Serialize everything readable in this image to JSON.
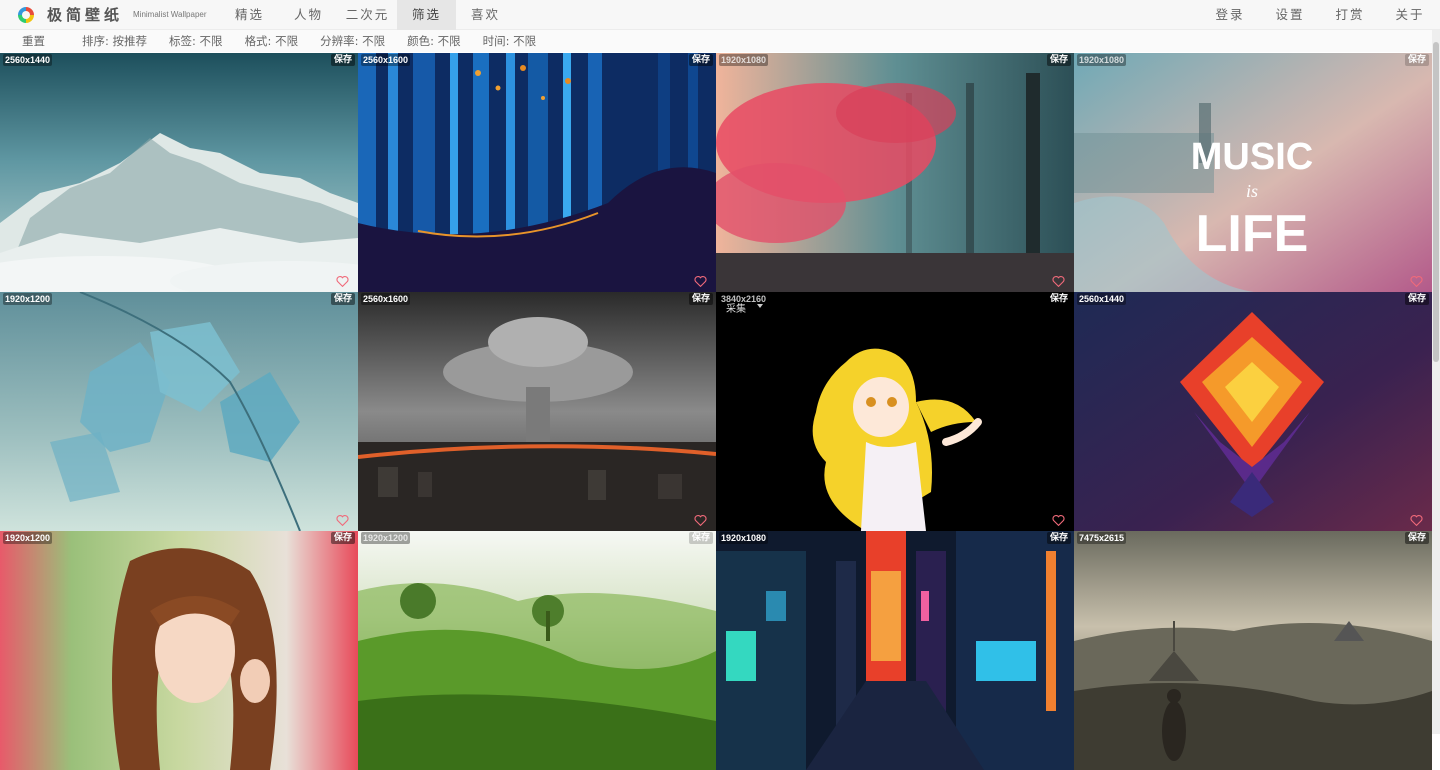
{
  "app": {
    "title": "极简壁纸",
    "subtitle": "Minimalist Wallpaper"
  },
  "nav": [
    {
      "label": "精选"
    },
    {
      "label": "人物"
    },
    {
      "label": "二次元"
    },
    {
      "label": "筛选"
    },
    {
      "label": "喜欢"
    }
  ],
  "active_nav": "筛选",
  "right_nav": [
    {
      "label": "登录"
    },
    {
      "label": "设置"
    },
    {
      "label": "打赏"
    },
    {
      "label": "关于"
    }
  ],
  "filters": {
    "reset": "重置",
    "sort": "排序: 按推荐",
    "tags": "标签: 不限",
    "format": "格式: 不限",
    "resolution": "分辨率: 不限",
    "color": "颜色: 不限",
    "time": "时间: 不限"
  },
  "tiles": [
    {
      "resolution": "2560x1440",
      "save": "保存",
      "scene": "mountain-icon"
    },
    {
      "resolution": "2560x1600",
      "save": "保存",
      "scene": "forest-icon"
    },
    {
      "resolution": "1920x1080",
      "save": "保存",
      "scene": "autumn-tree-icon"
    },
    {
      "resolution": "1920x1080",
      "save": "保存",
      "scene": "music-is-life-icon",
      "text_music": "MUSIC",
      "text_is": "is",
      "text_life": "LIFE"
    },
    {
      "resolution": "1920x1200",
      "save": "保存",
      "scene": "leaves-icon"
    },
    {
      "resolution": "2560x1600",
      "save": "保存",
      "scene": "mushroom-cloud-icon"
    },
    {
      "resolution": "3840x2160",
      "save": "保存",
      "scene": "anime-girl-icon",
      "collect": "采集"
    },
    {
      "resolution": "2560x1440",
      "save": "保存",
      "scene": "geometric-diamond-icon"
    },
    {
      "resolution": "1920x1200",
      "save": "保存",
      "scene": "portrait-icon"
    },
    {
      "resolution": "1920x1200",
      "save": "保存",
      "scene": "green-hills-icon"
    },
    {
      "resolution": "1920x1080",
      "save": "保存",
      "scene": "neon-city-icon"
    },
    {
      "resolution": "7475x2615",
      "save": "保存",
      "scene": "battlefield-icon"
    }
  ],
  "colors": {
    "heart": "#f06a7a",
    "nav_active_bg": "#e6e6e6"
  }
}
